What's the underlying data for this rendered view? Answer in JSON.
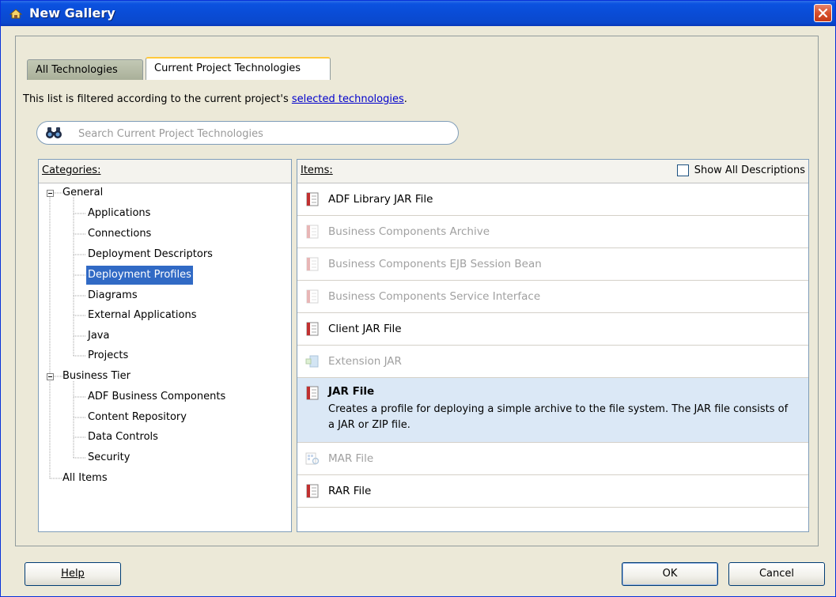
{
  "window": {
    "title": "New Gallery"
  },
  "tabs": [
    {
      "label": "All Technologies"
    },
    {
      "label": "Current Project Technologies"
    }
  ],
  "filter": {
    "prefix": "This list is filtered according to the current project's ",
    "link_text": "selected technologies",
    "suffix": "."
  },
  "search": {
    "placeholder": "Search Current Project Technologies"
  },
  "categories": {
    "header": "Categories:",
    "nodes": [
      {
        "label": "General"
      },
      {
        "label": "Applications"
      },
      {
        "label": "Connections"
      },
      {
        "label": "Deployment Descriptors"
      },
      {
        "label": "Deployment Profiles"
      },
      {
        "label": "Diagrams"
      },
      {
        "label": "External Applications"
      },
      {
        "label": "Java"
      },
      {
        "label": "Projects"
      },
      {
        "label": "Business Tier"
      },
      {
        "label": "ADF Business Components"
      },
      {
        "label": "Content Repository"
      },
      {
        "label": "Data Controls"
      },
      {
        "label": "Security"
      },
      {
        "label": "All Items"
      }
    ]
  },
  "items": {
    "header": "Items:",
    "show_all_label": "Show All Descriptions",
    "rows": [
      {
        "label": "ADF Library JAR File"
      },
      {
        "label": "Business Components Archive"
      },
      {
        "label": "Business Components EJB Session Bean"
      },
      {
        "label": "Business Components Service Interface"
      },
      {
        "label": "Client JAR File"
      },
      {
        "label": "Extension JAR"
      },
      {
        "label": "JAR File",
        "description": "Creates a profile for deploying a simple archive to the file system. The JAR file consists of a JAR or ZIP file."
      },
      {
        "label": "MAR File"
      },
      {
        "label": "RAR File"
      }
    ]
  },
  "buttons": {
    "help": "Help",
    "ok": "OK",
    "cancel": "Cancel"
  },
  "colors": {
    "title_bar": "#0a4cd6",
    "selection": "#316ac5",
    "selected_row": "#dbe8f6",
    "link": "#0000cc"
  }
}
